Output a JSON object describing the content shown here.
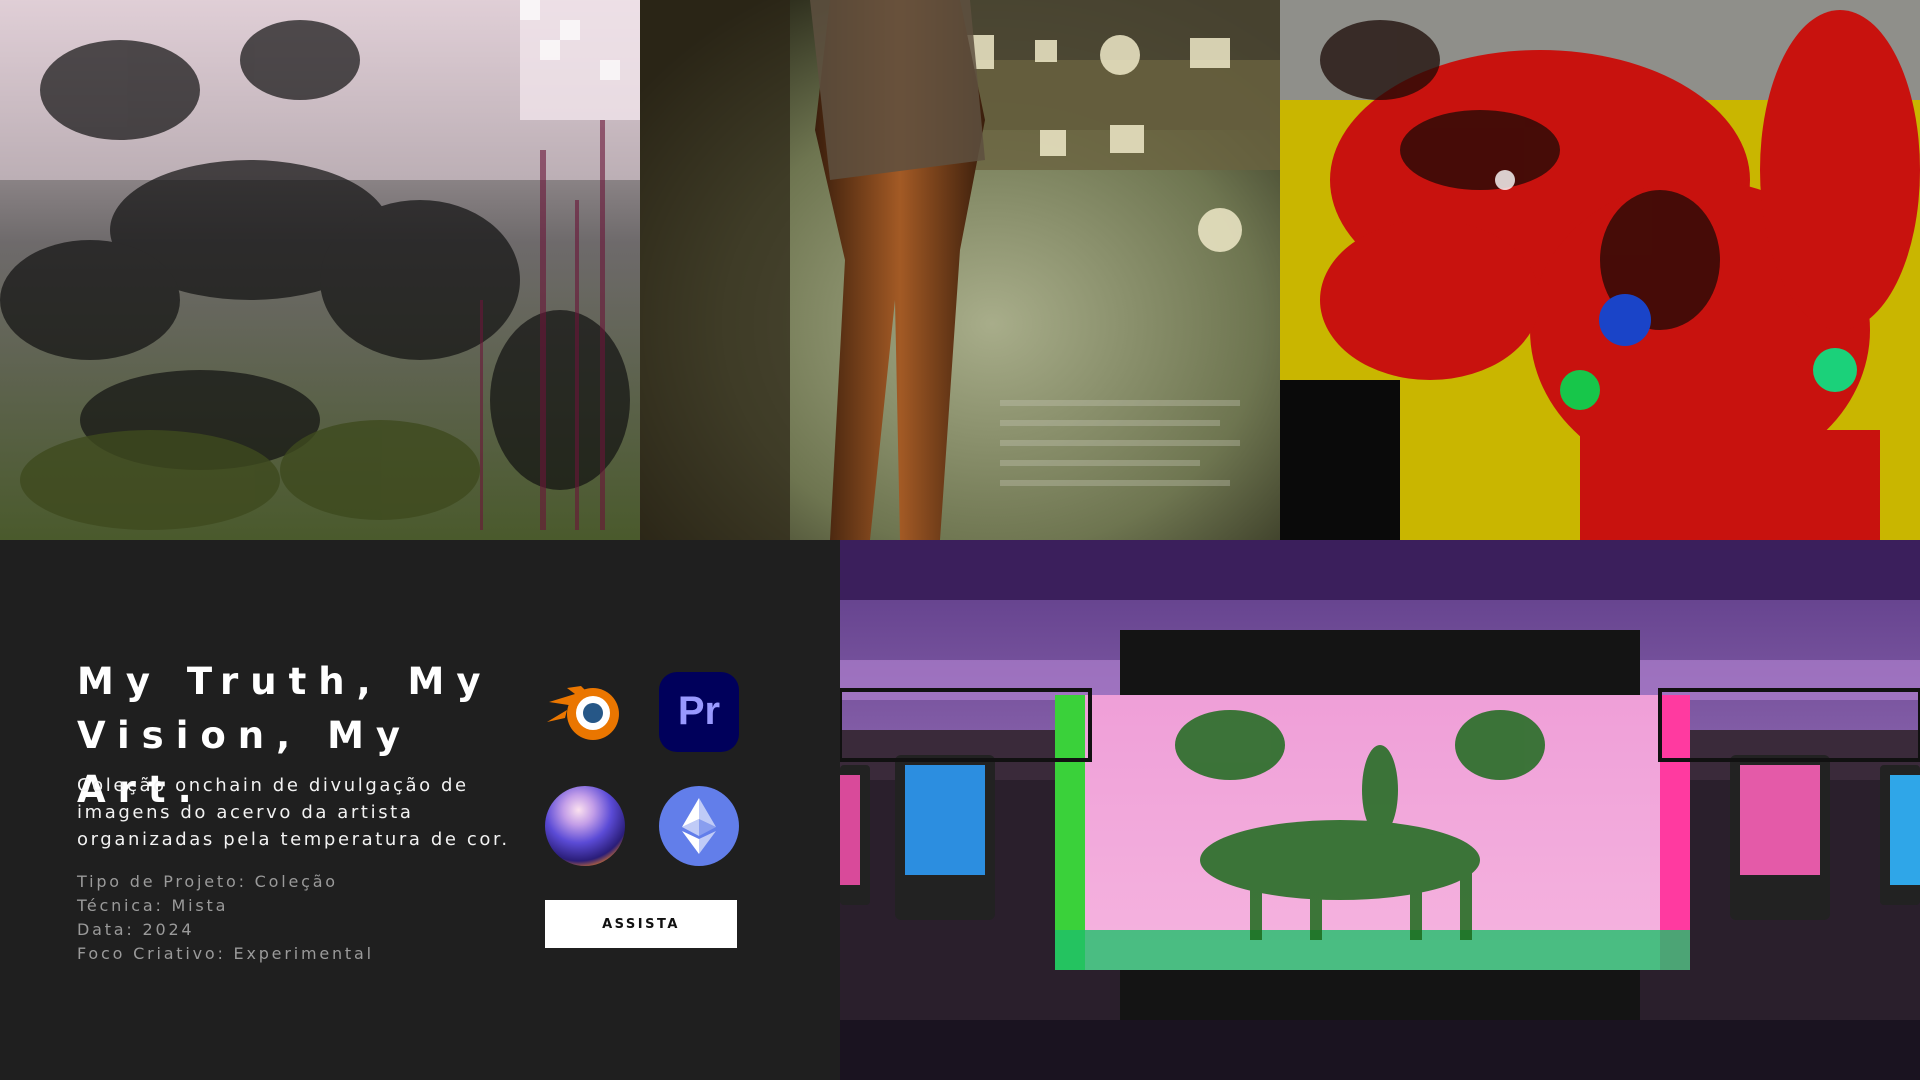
{
  "project": {
    "title": "My Truth, My Vision, My Art.",
    "description": "Coleção onchain de divulgação de imagens do acervo da artista organizadas pela temperatura de cor.",
    "meta": [
      "Tipo de Projeto: Coleção",
      "Técnica: Mista",
      "Data: 2024",
      "Foco Criativo: Experimental"
    ],
    "cta_label": "ASSISTA"
  },
  "tools": [
    {
      "icon": "blender-icon",
      "color": "#ea7600"
    },
    {
      "icon": "premiere-pro-icon",
      "label": "Pr",
      "color": "#9999ff"
    },
    {
      "icon": "3d-sphere-icon",
      "color": "#5b4bd6"
    },
    {
      "icon": "ethereum-icon",
      "color": "#627eea"
    }
  ],
  "colors": {
    "panel_background": "#1f1f1f",
    "title": "#ffffff",
    "meta_text": "#9a9a9a",
    "button_background": "#ffffff"
  }
}
